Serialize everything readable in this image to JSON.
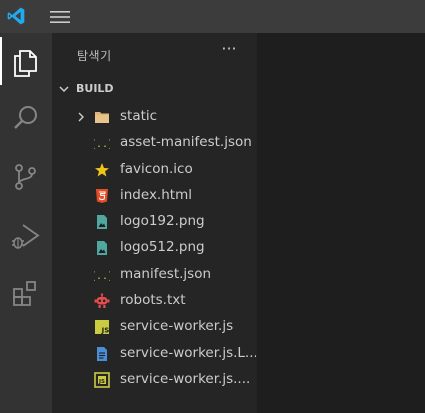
{
  "sidebar": {
    "title": "탐색기",
    "more_label": "···",
    "section_label": "BUILD",
    "items": [
      {
        "name": "static",
        "icon": "folder-icon",
        "type": "folder"
      },
      {
        "name": "asset-manifest.json",
        "icon": "json-icon",
        "type": "file"
      },
      {
        "name": "favicon.ico",
        "icon": "star-icon",
        "type": "file"
      },
      {
        "name": "index.html",
        "icon": "html5-icon",
        "type": "file"
      },
      {
        "name": "logo192.png",
        "icon": "image-icon",
        "type": "file"
      },
      {
        "name": "logo512.png",
        "icon": "image-icon",
        "type": "file"
      },
      {
        "name": "manifest.json",
        "icon": "json-icon",
        "type": "file"
      },
      {
        "name": "robots.txt",
        "icon": "robot-icon",
        "type": "file"
      },
      {
        "name": "service-worker.js",
        "icon": "js-icon",
        "type": "file"
      },
      {
        "name": "service-worker.js.L...",
        "icon": "document-icon",
        "type": "file"
      },
      {
        "name": "service-worker.js....",
        "icon": "js-map-icon",
        "type": "file"
      }
    ]
  },
  "activity_bar": [
    "explorer-icon",
    "search-icon",
    "source-control-icon",
    "run-debug-icon",
    "extensions-icon"
  ],
  "colors": {
    "titlebar": "#3c3c3c",
    "activity_bar": "#333333",
    "sidebar": "#252526",
    "editor": "#1e1e1e",
    "vscode_blue": "#23a9f2",
    "folder": "#dcb67a",
    "json": "#cbcb41",
    "html": "#e44d26",
    "image": "#4fa8a0",
    "js": "#cbcb41",
    "robot": "#e64d4d",
    "doc": "#4a8fd6"
  }
}
